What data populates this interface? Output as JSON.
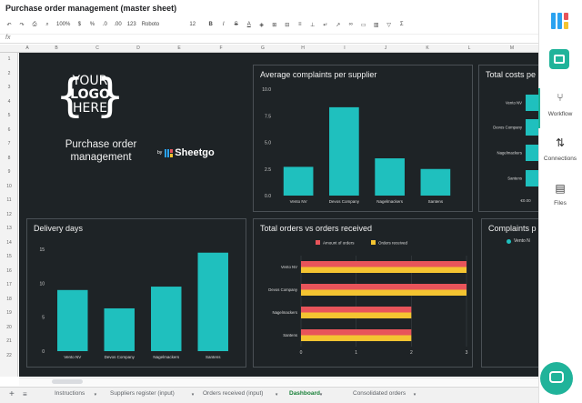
{
  "window": {
    "title": "Purchase order management (master sheet)"
  },
  "toolbar": {
    "zoom": "100%",
    "currency": "$",
    "percent": "%",
    "decimals_less": ".0",
    "decimals_more": ".00",
    "number_format": "123",
    "font": "Roboto",
    "font_size": "12",
    "bold": "B",
    "italic": "I",
    "strike": "S",
    "text_color": "A",
    "functions": "Σ"
  },
  "formula_bar": {
    "fx": "fx"
  },
  "columns": [
    "A",
    "B",
    "C",
    "D",
    "E",
    "F",
    "G",
    "H",
    "I",
    "J",
    "K",
    "L",
    "M"
  ],
  "rows": [
    "1",
    "2",
    "3",
    "4",
    "5",
    "6",
    "7",
    "8",
    "9",
    "10",
    "11",
    "12",
    "13",
    "14",
    "15",
    "16",
    "17",
    "18",
    "19",
    "20",
    "21",
    "22"
  ],
  "dashboard": {
    "logo": {
      "line1": "YOUR",
      "line2": "LOGO",
      "line3": "HERE"
    },
    "title_line1": "Purchase order",
    "title_line2": "management",
    "by": "by",
    "brand": "Sheetgo",
    "colors": {
      "bar": "#1fc0be",
      "red": "#e8545a",
      "yellow": "#f4c431",
      "bg": "#1e2326"
    }
  },
  "chart_data": [
    {
      "type": "bar",
      "title": "Average complaints per supplier",
      "categories": [
        "Vento NV",
        "Devos Company",
        "Nagelmackers",
        "Santens"
      ],
      "values": [
        2.7,
        8.3,
        3.5,
        2.5
      ],
      "ylim": [
        0,
        10
      ],
      "yticks": [
        "10.0",
        "7.5",
        "5.0",
        "2.5",
        "0.0"
      ],
      "grid": false
    },
    {
      "type": "bar",
      "title": "Delivery days",
      "categories": [
        "Vento NV",
        "Devos Company",
        "Nagelmackers",
        "Santens"
      ],
      "values": [
        9,
        6.3,
        9.5,
        14.5
      ],
      "ylim": [
        0,
        15
      ],
      "yticks": [
        "15",
        "10",
        "5",
        "0"
      ],
      "grid": false
    },
    {
      "type": "bar",
      "orientation": "horizontal",
      "title": "Total orders vs orders received",
      "categories": [
        "Vento NV",
        "Devos Company",
        "Nagelmackers",
        "Santens"
      ],
      "series": [
        {
          "name": "Amount of orders",
          "values": [
            3,
            3,
            2,
            2
          ]
        },
        {
          "name": "Orders received",
          "values": [
            3,
            3,
            2,
            2
          ]
        }
      ],
      "xlim": [
        0,
        3
      ],
      "xticks": [
        "0",
        "1",
        "2",
        "3"
      ],
      "legend": "top"
    },
    {
      "type": "bar",
      "orientation": "horizontal",
      "title": "Total costs pe",
      "categories": [
        "Vento NV",
        "Devos Company",
        "Nagelmackers",
        "Santens"
      ],
      "xticks": [
        "€0.00"
      ]
    },
    {
      "type": "pie",
      "title": "Complaints p",
      "legend_entries": [
        "Vento N"
      ]
    }
  ],
  "sheet_tabs": [
    {
      "label": "Instructions",
      "active": false
    },
    {
      "label": "Suppliers register (input)",
      "active": false
    },
    {
      "label": "Orders received (input)",
      "active": false
    },
    {
      "label": "Dashboard",
      "active": true
    },
    {
      "label": "Consolidated orders",
      "active": false
    }
  ],
  "sidebar": {
    "items": [
      {
        "label": "Workflow"
      },
      {
        "label": "Connections"
      },
      {
        "label": "Files"
      }
    ]
  }
}
